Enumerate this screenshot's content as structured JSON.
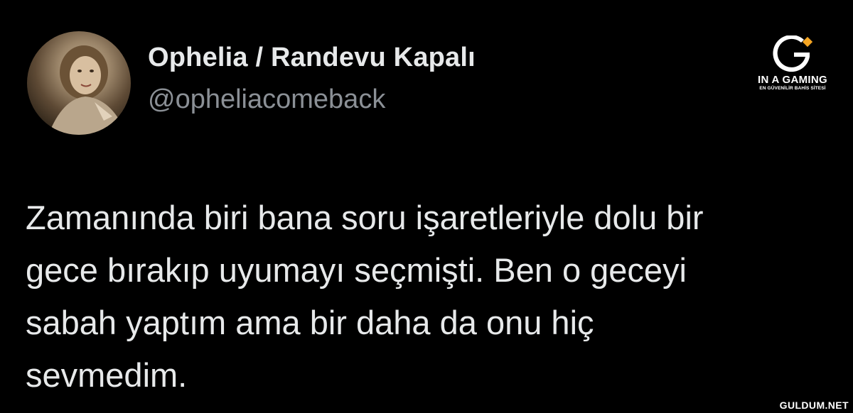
{
  "author": {
    "display_name": "Ophelia / Randevu Kapalı",
    "handle": "@opheliacomeback",
    "avatar_icon": "profile-photo"
  },
  "tweet": {
    "lines": [
      "Zamanında biri bana soru işaretleriyle dolu bir",
      "gece bırakıp uyumayı seçmişti. Ben o geceyi",
      "sabah yaptım ama bir daha da onu hiç",
      "sevmedim."
    ]
  },
  "overlay": {
    "brand_logo": {
      "name": "IN A GAMING",
      "tagline": "EN GÜVENİLİR BAHİS SİTESİ",
      "accent_color": "#f5a623"
    },
    "watermark": "GULDUM.NET"
  },
  "colors": {
    "background": "#000000",
    "primary_text": "#e7e9ea",
    "secondary_text": "#8b9096"
  }
}
